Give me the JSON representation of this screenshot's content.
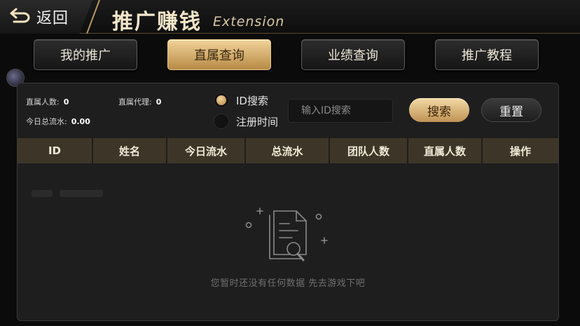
{
  "header": {
    "back_label": "返回",
    "title": "推广赚钱",
    "subtitle": "Extension"
  },
  "tabs": [
    {
      "label": "我的推广",
      "active": false
    },
    {
      "label": "直属查询",
      "active": true
    },
    {
      "label": "业绩查询",
      "active": false
    },
    {
      "label": "推广教程",
      "active": false
    }
  ],
  "stats": {
    "direct_members_label": "直属人数:",
    "direct_members_value": "0",
    "direct_agents_label": "直属代理:",
    "direct_agents_value": "0",
    "today_flow_label": "今日总流水:",
    "today_flow_value": "0.00"
  },
  "filters": {
    "options": [
      {
        "label": "ID搜索",
        "selected": true
      },
      {
        "label": "注册时间",
        "selected": false
      }
    ],
    "search_placeholder": "输入ID搜索",
    "search_value": "",
    "search_button": "搜索",
    "reset_button": "重置"
  },
  "table": {
    "columns": [
      "ID",
      "姓名",
      "今日流水",
      "总流水",
      "团队人数",
      "直属人数",
      "操作"
    ],
    "rows": []
  },
  "empty_state": {
    "message": "您暂时还没有任何数据 先去游戏下吧",
    "icon": "empty-document-search-icon"
  },
  "colors": {
    "accent_gold": "#c9a062",
    "active_tab_text": "#3a2710",
    "table_header_bg": "#3d3628"
  }
}
